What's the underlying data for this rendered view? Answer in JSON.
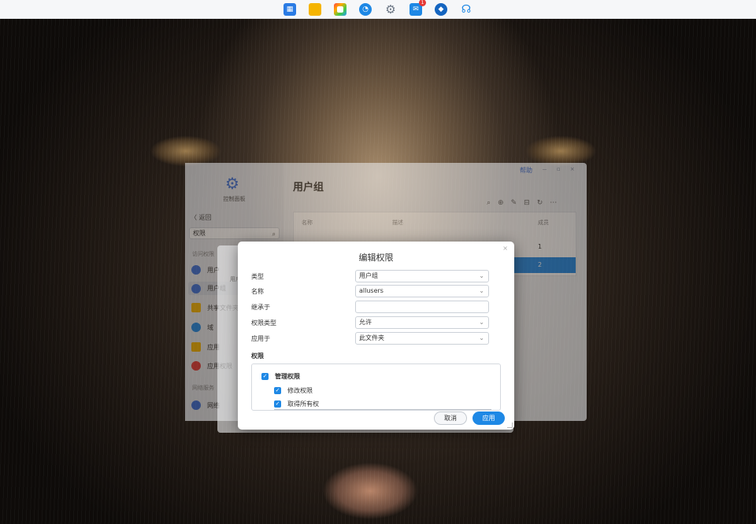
{
  "taskbar": {
    "apps": [
      {
        "icon": "app-grid-icon",
        "color": "#2a7be4"
      },
      {
        "icon": "folder-icon",
        "color": "#f5b400"
      },
      {
        "icon": "gallery-icon",
        "color": "#e94e77"
      },
      {
        "icon": "clock-icon",
        "color": "#1e88e5"
      },
      {
        "icon": "gear-icon",
        "color": "#6b7684"
      },
      {
        "icon": "mail-icon",
        "color": "#1e88e5",
        "badge": "1"
      },
      {
        "icon": "docker-icon",
        "color": "#1565c0"
      },
      {
        "icon": "headset-icon",
        "color": "#1e88e5"
      }
    ]
  },
  "control_panel": {
    "app_label": "控制面板",
    "back_label": "返回",
    "search_value": "权限",
    "section_access": "访问权限",
    "nav_items": [
      {
        "label": "用户",
        "icon": "user-icon",
        "color": "#3b6fd8"
      },
      {
        "label": "用户组",
        "icon": "user-group-icon",
        "color": "#3b6fd8",
        "active": true
      },
      {
        "label": "共享文件夹",
        "icon": "shared-folder-icon",
        "color": "#f5b400"
      },
      {
        "label": "域",
        "icon": "domain-icon",
        "color": "#1e88e5"
      },
      {
        "label": "应用",
        "icon": "app-folder-icon",
        "color": "#f5b400"
      },
      {
        "label": "应用权限",
        "icon": "app-permission-icon",
        "color": "#e53935"
      }
    ],
    "section_network": "网络服务",
    "nav_network": {
      "label": "网络",
      "icon": "network-icon",
      "color": "#3b6fd8"
    },
    "page_title": "用户组",
    "help_label": "帮助",
    "table": {
      "headers": [
        "名称",
        "描述",
        "成员"
      ],
      "rows": [
        {
          "members": "1"
        },
        {
          "members": "2",
          "selected": true
        }
      ]
    }
  },
  "middle_window": {
    "label": "用户"
  },
  "dialog": {
    "title": "编辑权限",
    "fields": [
      {
        "label": "类型",
        "value": "用户组",
        "dropdown": true
      },
      {
        "label": "名称",
        "value": "allusers",
        "dropdown": true
      },
      {
        "label": "继承于",
        "value": "",
        "dropdown": false
      },
      {
        "label": "权限类型",
        "value": "允许",
        "dropdown": true
      },
      {
        "label": "应用于",
        "value": "此文件夹",
        "dropdown": true
      }
    ],
    "permissions_title": "权限",
    "permissions": [
      {
        "label": "管理权限",
        "checked": true,
        "bold": true
      },
      {
        "label": "修改权限",
        "checked": true
      },
      {
        "label": "取得所有权",
        "checked": true
      }
    ],
    "cancel_label": "取消",
    "apply_label": "应用"
  }
}
